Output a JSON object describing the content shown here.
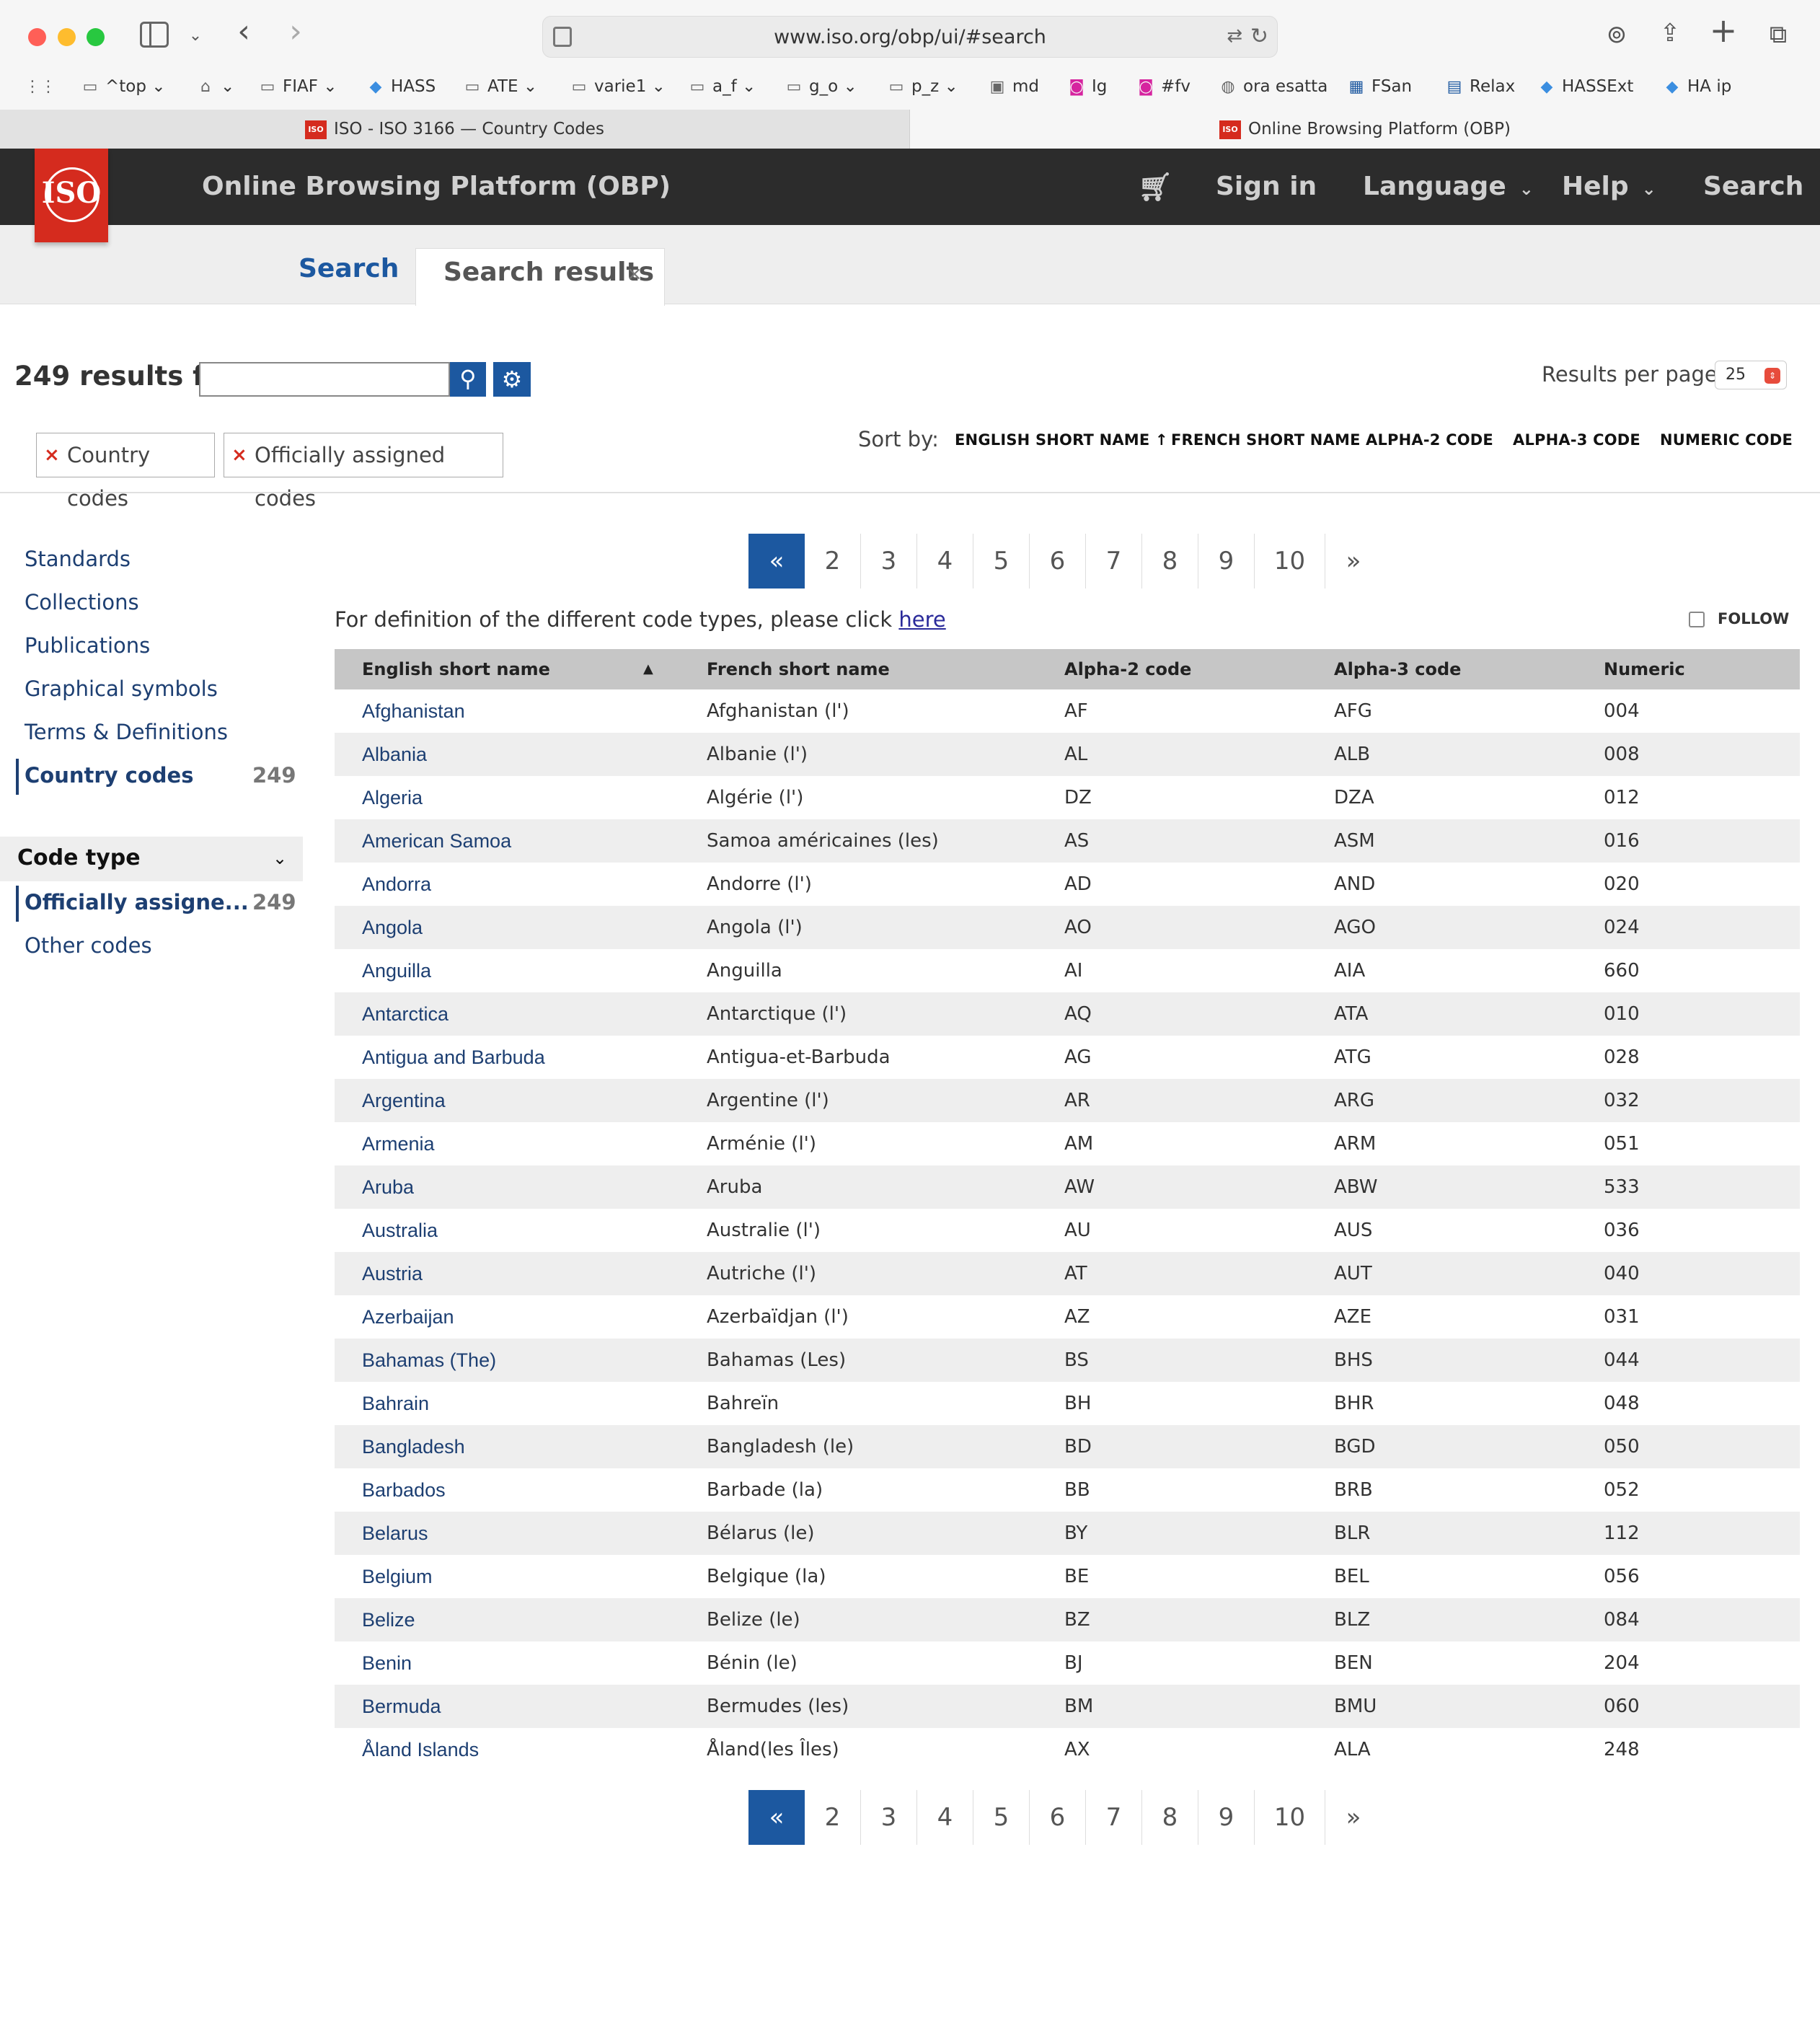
{
  "browser": {
    "url": "www.iso.org/obp/ui/#search",
    "bookmarks": [
      "^top",
      "",
      "FIAF",
      "HASS",
      "ATE",
      "varie1",
      "a_f",
      "g_o",
      "p_z",
      "md",
      "Ig",
      "#fv",
      "ora esatta",
      "FSan",
      "Relax",
      "HASSExt",
      "HA ip"
    ],
    "tabs": [
      "ISO - ISO 3166 — Country Codes",
      "Online Browsing Platform (OBP)"
    ]
  },
  "header": {
    "logo": "ISO",
    "title": "Online Browsing Platform (OBP)",
    "sign_in": "Sign in",
    "language": "Language",
    "help": "Help",
    "search": "Search"
  },
  "subtabs": {
    "search": "Search",
    "results": "Search results",
    "close": "×"
  },
  "search": {
    "count_label": "249 results for",
    "query": "",
    "results_per_page_label": "Results per page:",
    "results_per_page": "25"
  },
  "filters": [
    "Country codes",
    "Officially assigned codes"
  ],
  "sort": {
    "label": "Sort by:",
    "options": [
      "ENGLISH SHORT NAME",
      "FRENCH SHORT NAME",
      "ALPHA-2 CODE",
      "ALPHA-3 CODE",
      "NUMERIC CODE"
    ],
    "active_arrow": "↑"
  },
  "sidebar": {
    "items": [
      "Standards",
      "Collections",
      "Publications",
      "Graphical symbols",
      "Terms & Definitions",
      "Country codes"
    ],
    "country_count": "249",
    "code_type_label": "Code type",
    "official_label": "Officially assigne...",
    "official_count": "249",
    "other_label": "Other codes"
  },
  "pagination": [
    "«",
    "2",
    "3",
    "4",
    "5",
    "6",
    "7",
    "8",
    "9",
    "10",
    "»"
  ],
  "definition": {
    "text": "For definition of the different code types, please click ",
    "link": "here",
    "follow": "FOLLOW"
  },
  "table": {
    "headers": [
      "English short name",
      "French short name",
      "Alpha-2 code",
      "Alpha-3 code",
      "Numeric"
    ],
    "rows": [
      [
        "Afghanistan",
        "Afghanistan (l')",
        "AF",
        "AFG",
        "004"
      ],
      [
        "Albania",
        "Albanie (l')",
        "AL",
        "ALB",
        "008"
      ],
      [
        "Algeria",
        "Algérie (l')",
        "DZ",
        "DZA",
        "012"
      ],
      [
        "American Samoa",
        "Samoa américaines (les)",
        "AS",
        "ASM",
        "016"
      ],
      [
        "Andorra",
        "Andorre (l')",
        "AD",
        "AND",
        "020"
      ],
      [
        "Angola",
        "Angola (l')",
        "AO",
        "AGO",
        "024"
      ],
      [
        "Anguilla",
        "Anguilla",
        "AI",
        "AIA",
        "660"
      ],
      [
        "Antarctica",
        "Antarctique (l')",
        "AQ",
        "ATA",
        "010"
      ],
      [
        "Antigua and Barbuda",
        "Antigua-et-Barbuda",
        "AG",
        "ATG",
        "028"
      ],
      [
        "Argentina",
        "Argentine (l')",
        "AR",
        "ARG",
        "032"
      ],
      [
        "Armenia",
        "Arménie (l')",
        "AM",
        "ARM",
        "051"
      ],
      [
        "Aruba",
        "Aruba",
        "AW",
        "ABW",
        "533"
      ],
      [
        "Australia",
        "Australie (l')",
        "AU",
        "AUS",
        "036"
      ],
      [
        "Austria",
        "Autriche (l')",
        "AT",
        "AUT",
        "040"
      ],
      [
        "Azerbaijan",
        "Azerbaïdjan (l')",
        "AZ",
        "AZE",
        "031"
      ],
      [
        "Bahamas (The)",
        "Bahamas (Les)",
        "BS",
        "BHS",
        "044"
      ],
      [
        "Bahrain",
        "Bahreïn",
        "BH",
        "BHR",
        "048"
      ],
      [
        "Bangladesh",
        "Bangladesh (le)",
        "BD",
        "BGD",
        "050"
      ],
      [
        "Barbados",
        "Barbade (la)",
        "BB",
        "BRB",
        "052"
      ],
      [
        "Belarus",
        "Bélarus (le)",
        "BY",
        "BLR",
        "112"
      ],
      [
        "Belgium",
        "Belgique (la)",
        "BE",
        "BEL",
        "056"
      ],
      [
        "Belize",
        "Belize (le)",
        "BZ",
        "BLZ",
        "084"
      ],
      [
        "Benin",
        "Bénin (le)",
        "BJ",
        "BEN",
        "204"
      ],
      [
        "Bermuda",
        "Bermudes (les)",
        "BM",
        "BMU",
        "060"
      ],
      [
        "Åland Islands",
        "Åland(les Îles)",
        "AX",
        "ALA",
        "248"
      ]
    ]
  }
}
